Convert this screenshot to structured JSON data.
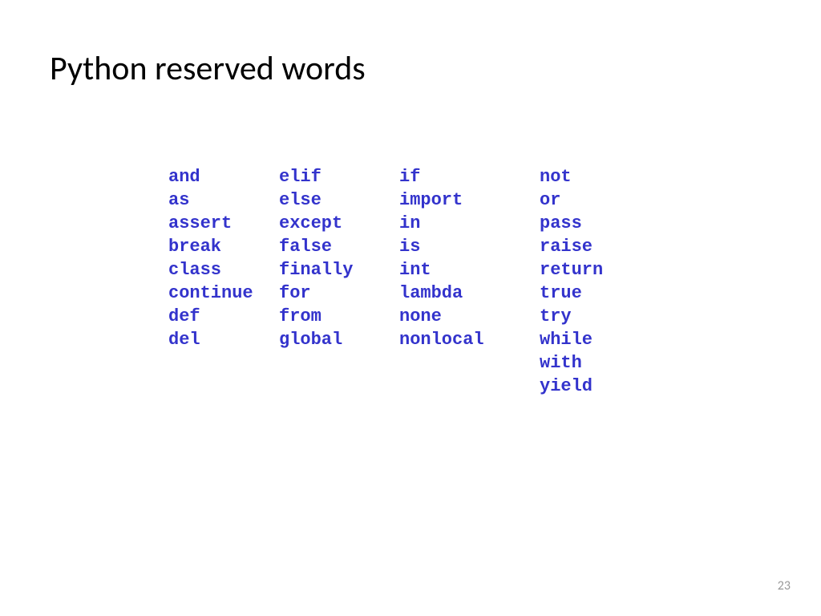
{
  "title": "Python reserved words",
  "columns": [
    [
      "and",
      "as",
      "assert",
      "break",
      "class",
      "continue",
      "def",
      "del"
    ],
    [
      "elif",
      "else",
      "except",
      "false",
      "finally",
      "for",
      "from",
      "global"
    ],
    [
      "if",
      "import",
      "in",
      "is",
      "int",
      "lambda",
      "none",
      "nonlocal"
    ],
    [
      "not",
      "or",
      "pass",
      "raise",
      "return",
      "true",
      "try",
      "while",
      "with",
      "yield"
    ]
  ],
  "page_number": "23"
}
